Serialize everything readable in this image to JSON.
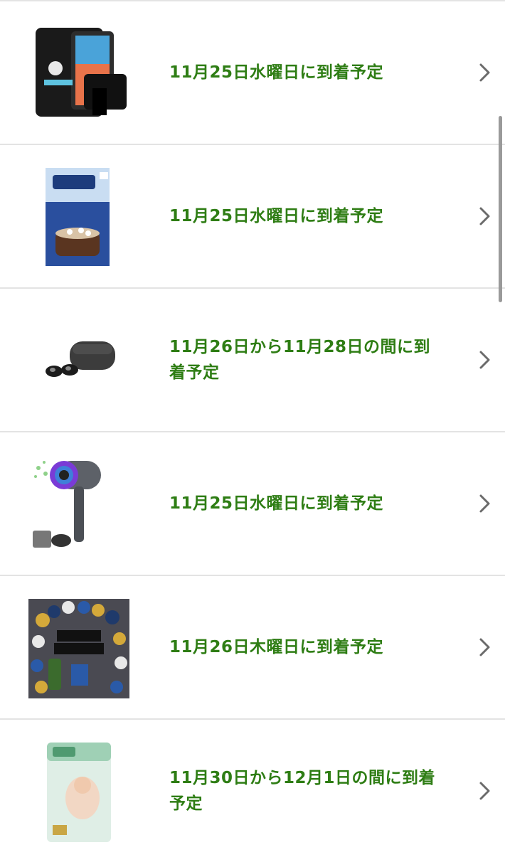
{
  "deliveries": [
    {
      "label": "11月25日水曜日に到着予定",
      "product_icon": "tablet-case-icon"
    },
    {
      "label": "11月25日水曜日に到着予定",
      "product_icon": "cocoa-box-icon"
    },
    {
      "label": "11月26日から11月28日の間に到着予定",
      "product_icon": "earbuds-icon"
    },
    {
      "label": "11月25日水曜日に到着予定",
      "product_icon": "hair-dryer-icon"
    },
    {
      "label": "11月26日木曜日に到着予定",
      "product_icon": "balloon-decoration-icon"
    },
    {
      "label": "11月30日から12月1日の間に到着予定",
      "product_icon": "diaper-pack-icon"
    }
  ],
  "colors": {
    "label": "#2e7d14",
    "divider": "#e3e3e3",
    "chevron": "#6b6b6b"
  }
}
